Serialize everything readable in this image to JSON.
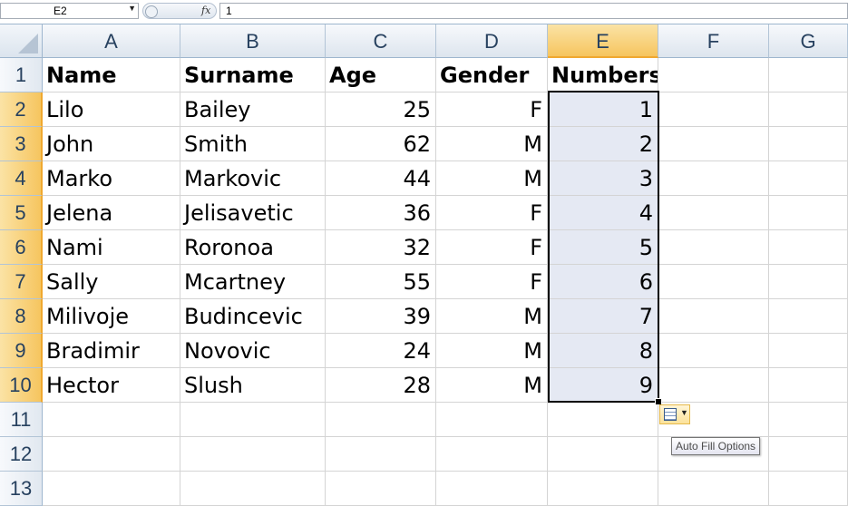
{
  "formula_bar": {
    "name_box": "E2",
    "fx": "fx",
    "formula": "1"
  },
  "columns": [
    "A",
    "B",
    "C",
    "D",
    "E",
    "F",
    "G"
  ],
  "selected_column": "E",
  "rows": [
    "1",
    "2",
    "3",
    "4",
    "5",
    "6",
    "7",
    "8",
    "9",
    "10",
    "11",
    "12",
    "13"
  ],
  "sheet": {
    "headers": [
      "Name",
      "Surname",
      "Age",
      "Gender",
      "Numbers"
    ],
    "data": [
      [
        "Lilo",
        "Bailey",
        "25",
        "F",
        "1"
      ],
      [
        "John",
        "Smith",
        "62",
        "M",
        "2"
      ],
      [
        "Marko",
        "Markovic",
        "44",
        "M",
        "3"
      ],
      [
        "Jelena",
        "Jelisavetic",
        "36",
        "F",
        "4"
      ],
      [
        "Nami",
        "Roronoa",
        "32",
        "F",
        "5"
      ],
      [
        "Sally",
        "Mcartney",
        "55",
        "F",
        "6"
      ],
      [
        "Milivoje",
        "Budincevic",
        "39",
        "M",
        "7"
      ],
      [
        "Bradimir",
        "Novovic",
        "24",
        "M",
        "8"
      ],
      [
        "Hector",
        "Slush",
        "28",
        "M",
        "9"
      ]
    ]
  },
  "auto_fill": {
    "tooltip": "Auto Fill Options",
    "icon": "auto-fill-options-icon"
  },
  "colors": {
    "selected_header": "#f6c55f",
    "selection_fill": "#e5e9f3",
    "grid_line": "#d4d4d4"
  }
}
